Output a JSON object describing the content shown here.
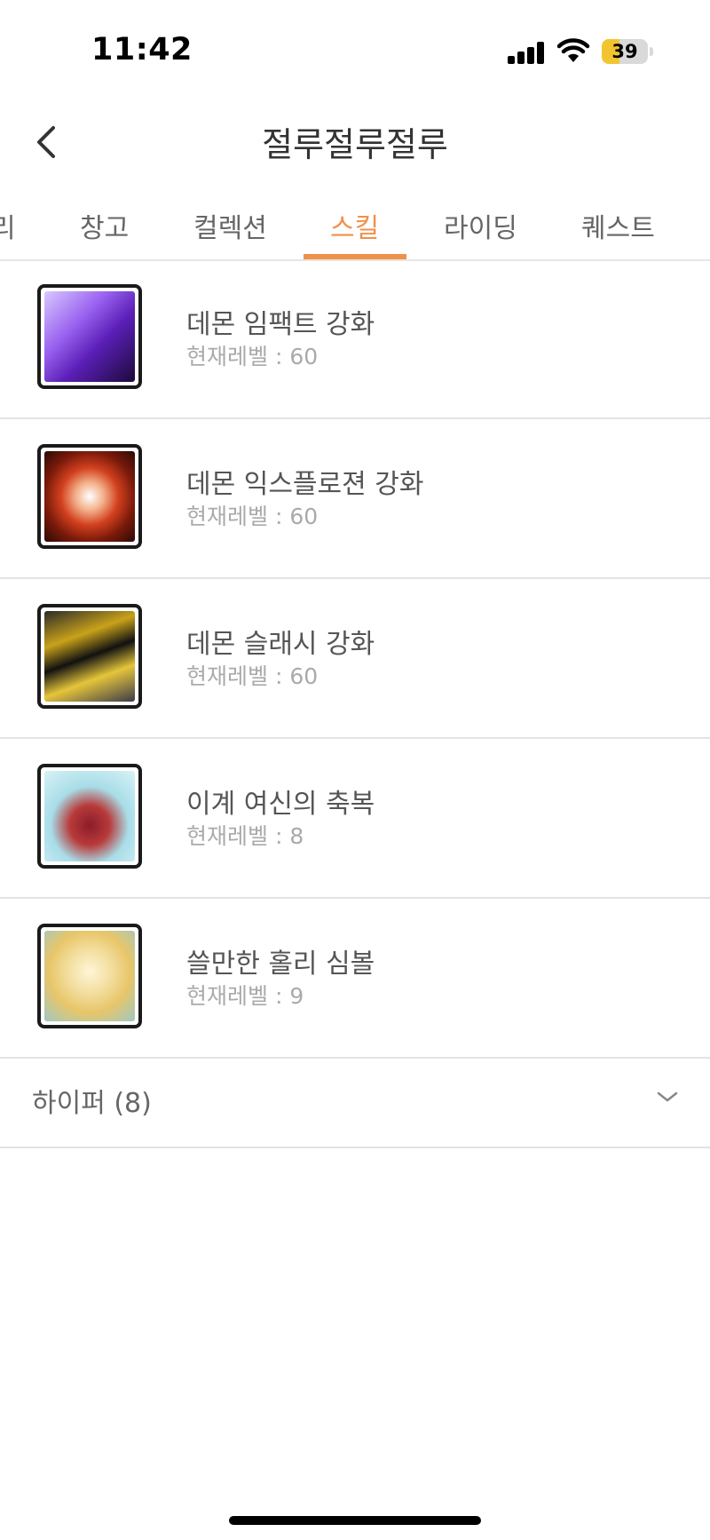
{
  "status_bar": {
    "time": "11:42",
    "battery": "39",
    "battery_color": "#f2c530"
  },
  "header": {
    "title": "절루절루절루",
    "back_icon": "chevron-left-icon"
  },
  "tabs": [
    {
      "label": "리"
    },
    {
      "label": "창고"
    },
    {
      "label": "컬렉션"
    },
    {
      "label": "스킬",
      "active": true
    },
    {
      "label": "라이딩"
    },
    {
      "label": "퀘스트"
    }
  ],
  "accent_color": "#f0914a",
  "skills": [
    {
      "name": "데몬 임팩트 강화",
      "level": "현재레벨 : 60",
      "icon": "demon-impact-icon"
    },
    {
      "name": "데몬 익스플로젼 강화",
      "level": "현재레벨 : 60",
      "icon": "demon-explosion-icon"
    },
    {
      "name": "데몬 슬래시 강화",
      "level": "현재레벨 : 60",
      "icon": "demon-slash-icon"
    },
    {
      "name": "이계 여신의 축복",
      "level": "현재레벨 : 8",
      "icon": "goddess-blessing-icon"
    },
    {
      "name": "쓸만한 홀리 심볼",
      "level": "현재레벨 : 9",
      "icon": "holy-symbol-icon"
    }
  ],
  "hyper": {
    "label": "하이퍼 (8)",
    "icon": "chevron-down-icon"
  }
}
